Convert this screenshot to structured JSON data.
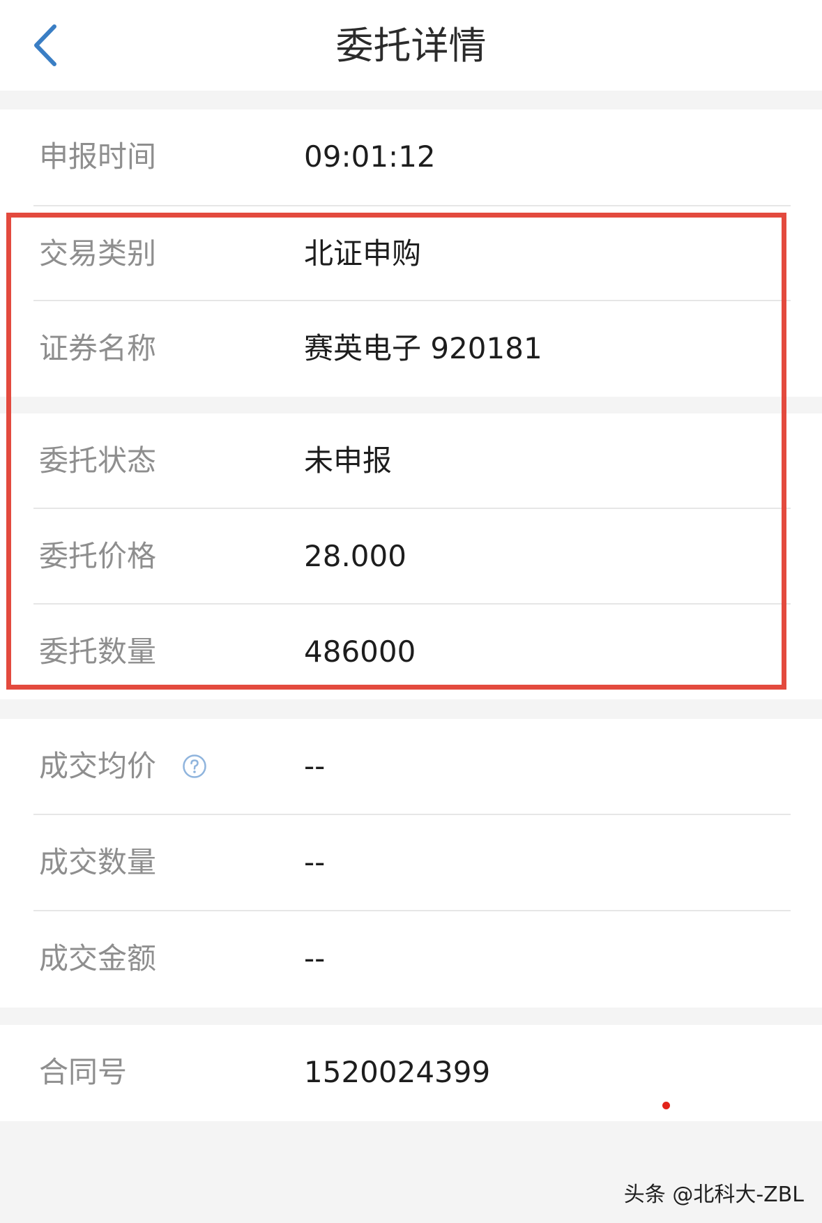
{
  "header": {
    "title": "委托详情",
    "back_icon": "chevron-left-icon"
  },
  "details": {
    "report_time": {
      "label": "申报时间",
      "value": "09:01:12"
    },
    "trade_type": {
      "label": "交易类别",
      "value": "北证申购"
    },
    "security_name": {
      "label": "证券名称",
      "value": "赛英电子 920181"
    },
    "order_status": {
      "label": "委托状态",
      "value": "未申报"
    },
    "order_price": {
      "label": "委托价格",
      "value": "28.000"
    },
    "order_quantity": {
      "label": "委托数量",
      "value": "486000"
    },
    "avg_price": {
      "label": "成交均价",
      "value": "--",
      "help_icon": "question-circle-icon"
    },
    "filled_quantity": {
      "label": "成交数量",
      "value": "--"
    },
    "filled_amount": {
      "label": "成交金额",
      "value": "--"
    },
    "contract_no": {
      "label": "合同号",
      "value": "1520024399"
    }
  },
  "watermark": "头条 @北科大-ZBL",
  "colors": {
    "highlight_border": "#e34a3e",
    "back_icon": "#3a7ec4",
    "help_icon": "#8fb4dd"
  }
}
